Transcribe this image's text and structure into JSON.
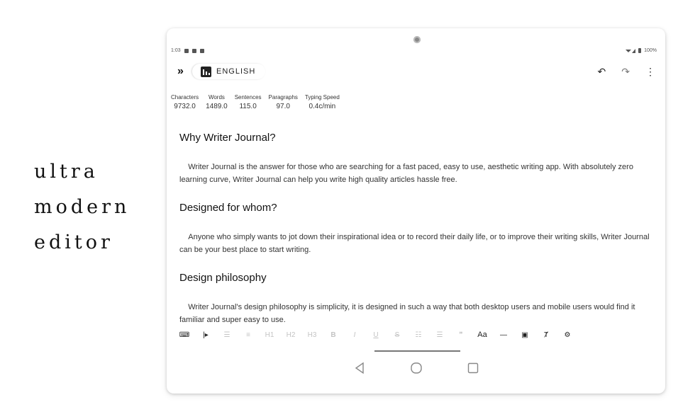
{
  "tagline": {
    "line1": "ultra",
    "line2": "modern",
    "line3": "editor"
  },
  "status_bar": {
    "time": "1:03",
    "battery": "100%"
  },
  "toolbar": {
    "language": "ENGLISH"
  },
  "stats": [
    {
      "label": "Characters",
      "value": "9732.0"
    },
    {
      "label": "Words",
      "value": "1489.0"
    },
    {
      "label": "Sentences",
      "value": "115.0"
    },
    {
      "label": "Paragraphs",
      "value": "97.0"
    },
    {
      "label": "Typing Speed",
      "value": "0.4c/min"
    }
  ],
  "document": {
    "heading1": "Why Writer Journal?",
    "para1": "Writer Journal is the answer for those who are searching for a fast paced, easy to use, aesthetic writing app. With absolutely zero learning curve, Writer Journal can help you write high quality articles hassle free.",
    "heading2": "Designed for whom?",
    "para2": "Anyone who simply wants to jot down their inspirational idea or to record their daily life, or to improve their writing skills, Writer Journal can be your best place to start writing.",
    "heading3": "Design philosophy",
    "para3": "Writer Journal's design philosophy is simplicity, it is designed in such a way that both desktop users and mobile users would find it familiar and super easy to use."
  },
  "format_toolbar": {
    "h1": "H1",
    "h2": "H2",
    "h3": "H3",
    "bold": "B",
    "italic": "I",
    "underline": "U",
    "strike": "S",
    "quote": "❞",
    "font": "Aa"
  },
  "colors": {
    "text": "#222222",
    "disabled": "#c4c4c4",
    "background": "#ffffff"
  }
}
